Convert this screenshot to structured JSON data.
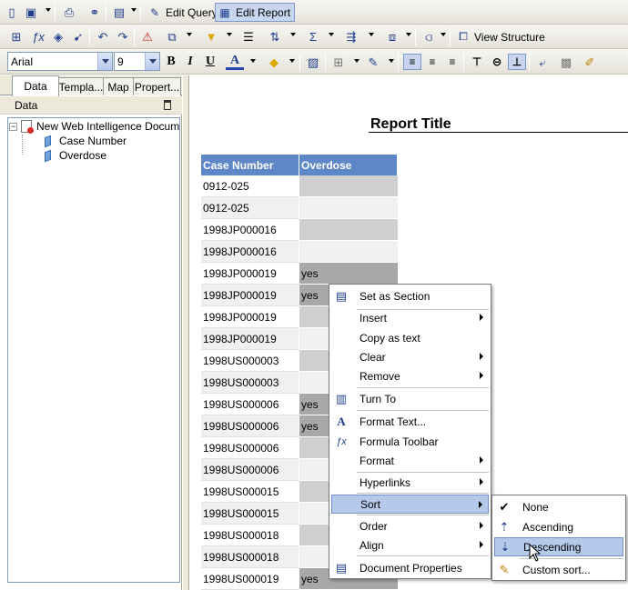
{
  "toolbar": {
    "edit_query": "Edit Query",
    "edit_report": "Edit Report",
    "view_structure": "View Structure"
  },
  "format_toolbar": {
    "font": "Arial",
    "size": "9",
    "bold": "B",
    "italic": "I",
    "underline": "U",
    "font_color_glyph": "A"
  },
  "panel": {
    "tabs": [
      "Data",
      "Templa...",
      "Map",
      "Propert..."
    ],
    "title": "Data",
    "tree": {
      "root": "New Web Intelligence Document",
      "children": [
        "Case Number",
        "Overdose"
      ]
    }
  },
  "report": {
    "title": "Report Title",
    "columns": [
      "Case Number",
      "Overdose"
    ],
    "rows": [
      {
        "case": "0912-025",
        "overdose": ""
      },
      {
        "case": "0912-025",
        "overdose": ""
      },
      {
        "case": "1998JP000016",
        "overdose": ""
      },
      {
        "case": "1998JP000016",
        "overdose": ""
      },
      {
        "case": "1998JP000019",
        "overdose": "yes"
      },
      {
        "case": "1998JP000019",
        "overdose": "yes"
      },
      {
        "case": "1998JP000019",
        "overdose": ""
      },
      {
        "case": "1998JP000019",
        "overdose": ""
      },
      {
        "case": "1998US000003",
        "overdose": ""
      },
      {
        "case": "1998US000003",
        "overdose": ""
      },
      {
        "case": "1998US000006",
        "overdose": "yes"
      },
      {
        "case": "1998US000006",
        "overdose": "yes"
      },
      {
        "case": "1998US000006",
        "overdose": ""
      },
      {
        "case": "1998US000006",
        "overdose": ""
      },
      {
        "case": "1998US000015",
        "overdose": ""
      },
      {
        "case": "1998US000015",
        "overdose": ""
      },
      {
        "case": "1998US000018",
        "overdose": ""
      },
      {
        "case": "1998US000018",
        "overdose": ""
      },
      {
        "case": "1998US000019",
        "overdose": "yes"
      }
    ]
  },
  "context_menu": {
    "items": {
      "set_as_section": "Set as Section",
      "insert": "Insert",
      "copy_as_text": "Copy as text",
      "clear": "Clear",
      "remove": "Remove",
      "turn_to": "Turn To",
      "format_text": "Format Text...",
      "formula_toolbar": "Formula Toolbar",
      "format": "Format",
      "hyperlinks": "Hyperlinks",
      "sort": "Sort",
      "order": "Order",
      "align": "Align",
      "document_properties": "Document Properties"
    }
  },
  "sort_submenu": {
    "none": "None",
    "ascending": "Ascending",
    "descending": "Descending",
    "custom_sort": "Custom sort..."
  },
  "colors": {
    "header_bg": "#5e87c7",
    "menu_highlight": "#b5c9ea",
    "cell_gray": "#d0d0d0",
    "cell_light": "#f0f0f0"
  }
}
